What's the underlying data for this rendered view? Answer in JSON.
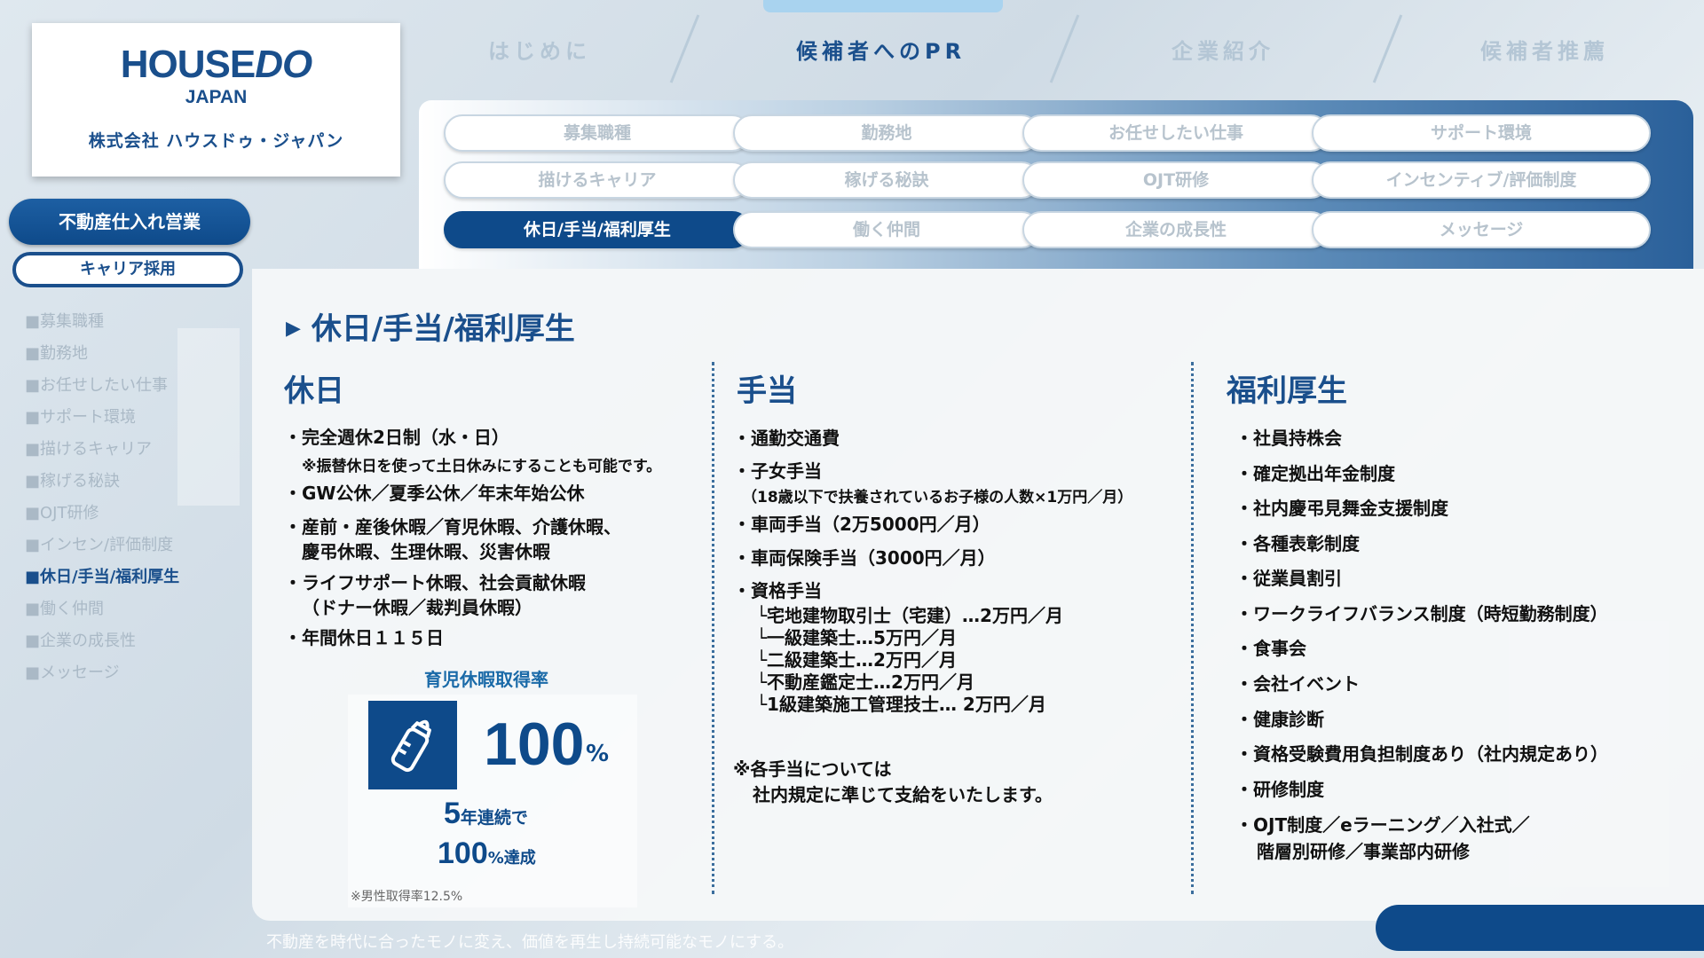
{
  "logo": {
    "main_a": "HOUSE",
    "main_b": "DO",
    "sub": "JAPAN",
    "company": "株式会社 ハウスドゥ・ジャパン"
  },
  "top_nav": [
    {
      "label": "はじめに",
      "active": false
    },
    {
      "label": "候補者へのPR",
      "active": true
    },
    {
      "label": "企業紹介",
      "active": false
    },
    {
      "label": "候補者推薦",
      "active": false
    }
  ],
  "sidebar": {
    "main_button": "不動産仕入れ営業",
    "sub_button": "キャリア採用",
    "items": [
      "■募集職種",
      "■勤務地",
      "■お任せしたい仕事",
      "■サポート環境",
      "■描けるキャリア",
      "■稼げる秘訣",
      "■OJT研修",
      "■インセン/評価制度",
      "■休日/手当/福利厚生",
      "■働く仲間",
      "■企業の成長性",
      "■メッセージ"
    ],
    "active_index": 8
  },
  "subnav": {
    "rows": [
      [
        "募集職種",
        "勤務地",
        "お任せしたい仕事",
        "サポート環境"
      ],
      [
        "描けるキャリア",
        "稼げる秘訣",
        "OJT研修",
        "インセンティブ/評価制度"
      ],
      [
        "休日/手当/福利厚生",
        "働く仲間",
        "企業の成長性",
        "メッセージ"
      ]
    ],
    "active": "休日/手当/福利厚生"
  },
  "content": {
    "title": "休日/手当/福利厚生",
    "holidays": {
      "title": "休日",
      "b1": "・完全週休2日制（水・日）",
      "b1_note": "※振替休日を使って土日休みにすることも可能です。",
      "b2": "・GW公休／夏季公休／年末年始公休",
      "b3a": "・産前・産後休暇／育児休暇、介護休暇、",
      "b3b": "慶弔休暇、生理休暇、災害休暇",
      "b4a": "・ライフサポート休暇、社会貢献休暇",
      "b4b": "（ドナー休暇／裁判員休暇）",
      "b5": "・年間休日１１５日",
      "stat_label": "育児休暇取得率",
      "stat_value": "100",
      "stat_pct": "%",
      "years_num": "5",
      "years_text": "年連続で",
      "ach_num": "100",
      "ach_text": "%達成",
      "male_note": "※男性取得率12.5%"
    },
    "allowances": {
      "title": "手当",
      "b1": "・通勤交通費",
      "b2": "・子女手当",
      "b2_note": "（18歳以下で扶養されているお子様の人数×1万円／月）",
      "b3": "・車両手当（2万5000円／月）",
      "b4": "・車両保険手当（3000円／月）",
      "b5": "・資格手当",
      "q1": "└宅地建物取引士（宅建）…2万円／月",
      "q2": "└一級建築士…5万円／月",
      "q3": "└二級建築士…2万円／月",
      "q4": "└不動産鑑定士…2万円／月",
      "q5": "└1級建築施工管理技士… 2万円／月",
      "note1": "※各手当については",
      "note2": "社内規定に準じて支給をいたします。"
    },
    "welfare": {
      "title": "福利厚生",
      "items": [
        "・社員持株会",
        "・確定拠出年金制度",
        "・社内慶弔見舞金支援制度",
        "・各種表彰制度",
        "・従業員割引",
        "・ワークライフバランス制度（時短勤務制度）",
        "・食事会",
        "・会社イベント",
        "・健康診断",
        "・資格受験費用負担制度あり（社内規定あり）",
        "・研修制度",
        "・OJT制度／eラーニング／入社式／"
      ],
      "last_cont": "階層別研修／事業部内研修"
    }
  },
  "footer": {
    "tagline": "不動産を時代に合ったモノに変え、価値を再生し持続可能なモノにする。"
  },
  "colors": {
    "brand": "#1a4f8c",
    "active_pill": "#0e4a8a"
  }
}
